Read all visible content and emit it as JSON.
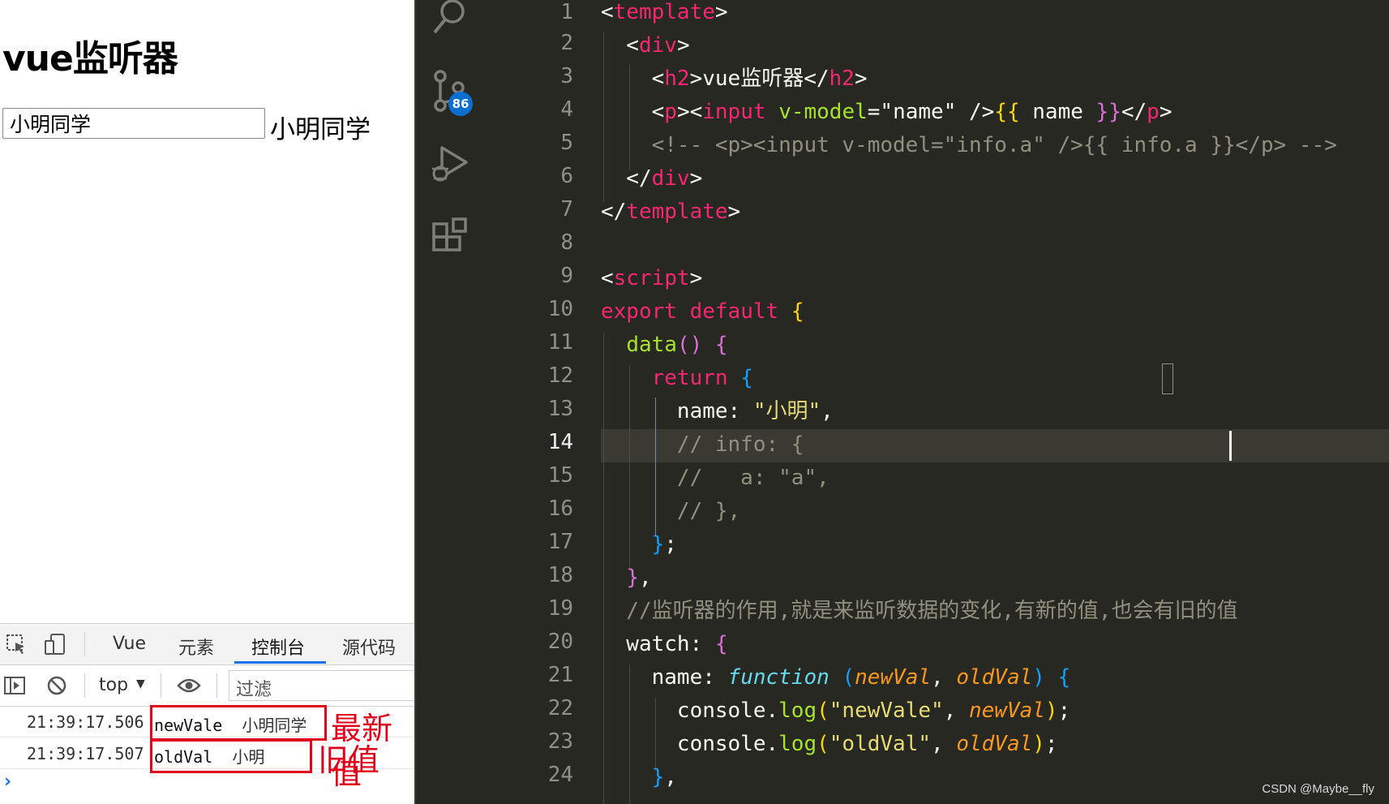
{
  "browser": {
    "page_title": "vue监听器",
    "name_input_value": "小明同学",
    "name_echo": "小明同学"
  },
  "devtools": {
    "tabs": [
      {
        "label": "Vue"
      },
      {
        "label": "元素"
      },
      {
        "label": "控制台",
        "active": true
      },
      {
        "label": "源代码"
      }
    ],
    "context_select": "top",
    "filter_placeholder": "过滤",
    "logs": [
      {
        "time": "21:39:17.506",
        "label": "newVale",
        "value": "小明同学",
        "note": "最新值"
      },
      {
        "time": "21:39:17.507",
        "label": "oldVal",
        "value": "小明",
        "note": "旧值"
      }
    ],
    "prompt": "›"
  },
  "editor": {
    "scm_badge": "86",
    "current_line": 14,
    "line_numbers": [
      "1",
      "2",
      "3",
      "4",
      "5",
      "6",
      "7",
      "8",
      "9",
      "10",
      "11",
      "12",
      "13",
      "14",
      "15",
      "16",
      "17",
      "18",
      "19",
      "20",
      "21",
      "22",
      "23",
      "24"
    ],
    "code": {
      "l1": [
        "<",
        "template",
        ">"
      ],
      "l2": [
        "  <",
        "div",
        ">"
      ],
      "l3": [
        "    <",
        "h2",
        ">vue监听器</",
        "h2",
        ">"
      ],
      "l4": [
        "    <",
        "p",
        "><",
        "input",
        " ",
        "v-model",
        "=",
        "\"name\"",
        " />",
        "{{",
        " name ",
        "}}",
        "</",
        "p",
        ">"
      ],
      "l5": "    <!-- <p><input v-model=\"info.a\" />{{ info.a }}</p> -->",
      "l6": [
        "  </",
        "div",
        ">"
      ],
      "l7": [
        "</",
        "template",
        ">"
      ],
      "l9": [
        "<",
        "script",
        ">"
      ],
      "l10": [
        "export",
        " ",
        "default",
        " ",
        "{"
      ],
      "l11": [
        "  ",
        "data",
        "()",
        " ",
        "{"
      ],
      "l12": [
        "    ",
        "return",
        " ",
        "{"
      ],
      "l13": [
        "      name: ",
        "\"小明\"",
        ","
      ],
      "l14": "      // info: {",
      "l15": "      //   a: \"a\",",
      "l16": "      // },",
      "l17": [
        "    ",
        "}",
        ";"
      ],
      "l18": [
        "  ",
        "}",
        ","
      ],
      "l19": "  //监听器的作用,就是来监听数据的变化,有新的值,也会有旧的值",
      "l20": [
        "  watch: ",
        "{"
      ],
      "l21": [
        "    name: ",
        "function",
        " ",
        "(",
        "newVal",
        ", ",
        "oldVal",
        ")",
        " ",
        "{"
      ],
      "l22": [
        "      console.",
        "log",
        "(",
        "\"newVale\"",
        ", ",
        "newVal",
        ")",
        ";"
      ],
      "l23": [
        "      console.",
        "log",
        "(",
        "\"oldVal\"",
        ", ",
        "oldVal",
        ")",
        ";"
      ],
      "l24": [
        "    ",
        "}",
        ","
      ]
    }
  },
  "watermark": "CSDN @Maybe__fly",
  "colors": {
    "editor_bg": "#272822",
    "tag": "#f92672",
    "string": "#e6db74",
    "function": "#a6e22e",
    "comment": "#909080",
    "param": "#fd971f",
    "annotation_red": "#e0001b",
    "devtools_accent": "#1a73e8"
  }
}
